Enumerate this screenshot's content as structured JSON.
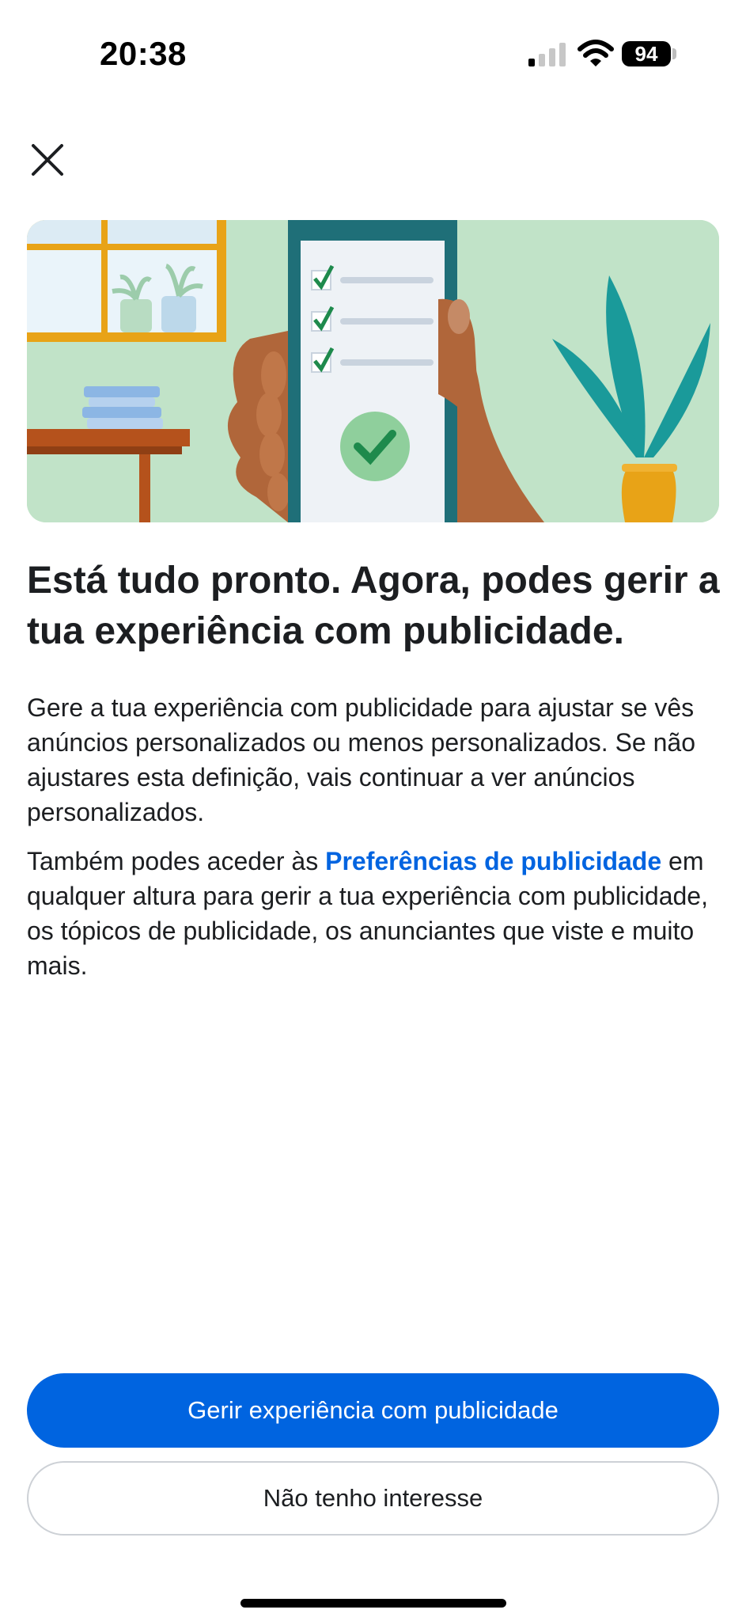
{
  "status_bar": {
    "time": "20:38",
    "battery": "94",
    "icons": [
      "signal-icon",
      "wifi-icon",
      "battery-icon"
    ]
  },
  "close_icon": "close-icon",
  "hero_illustration": {
    "description_icons": [
      "window-icon",
      "plant-icon",
      "books-icon",
      "table-icon",
      "phone-checklist-icon",
      "hand-icon",
      "potted-plant-icon"
    ],
    "colors": {
      "background": "#c1e3c8",
      "window_frame": "#e8a317",
      "phone": "#1f6f78",
      "check": "#1e8a4c",
      "plant": "#1a9a9a",
      "pot": "#e8a317",
      "skin": "#b0663a"
    }
  },
  "content": {
    "headline": "Está tudo pronto. Agora, podes gerir a tua experiência com publicidade.",
    "paragraph1": "Gere a tua experiência com publicidade para ajustar se vês anúncios personalizados ou menos personalizados. Se não ajustares esta definição, vais continuar a ver anúncios personalizados.",
    "paragraph2_prefix": "Também podes aceder às ",
    "paragraph2_link": "Preferências de publicidade",
    "paragraph2_suffix": " em qualquer altura para gerir a tua experiência com publicidade, os tópicos de publicidade, os anunciantes que viste e muito mais."
  },
  "buttons": {
    "primary": "Gerir experiência com publicidade",
    "secondary": "Não tenho interesse"
  },
  "colors": {
    "accent": "#0064e0",
    "text": "#1c1e21",
    "border": "#cdd1d6"
  }
}
